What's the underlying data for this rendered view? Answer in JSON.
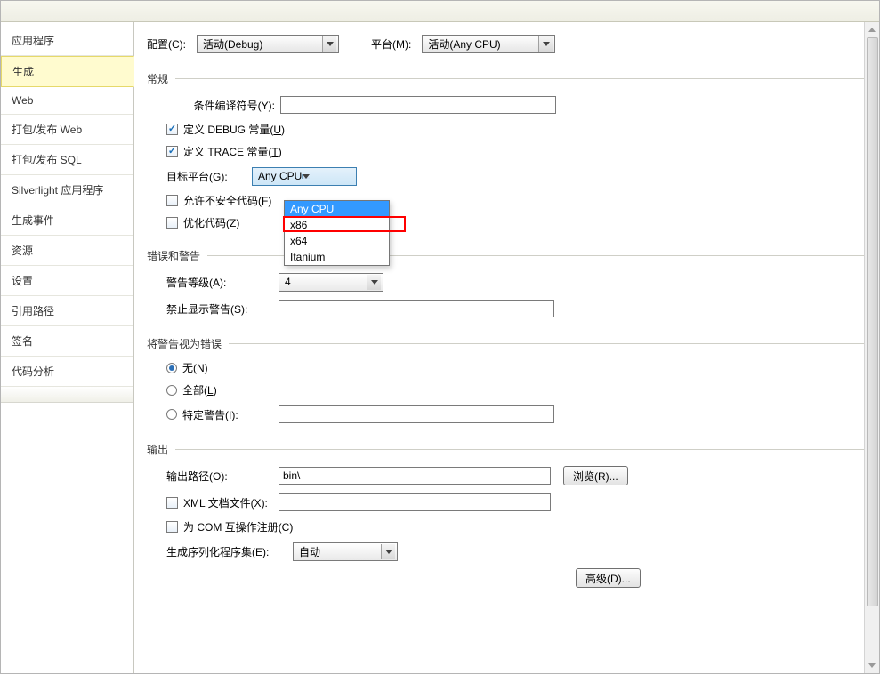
{
  "tabs": {
    "application": "应用程序",
    "build": "生成",
    "web": "Web",
    "pack_web": "打包/发布 Web",
    "pack_sql": "打包/发布 SQL",
    "silverlight": "Silverlight 应用程序",
    "build_events": "生成事件",
    "resources": "资源",
    "settings": "设置",
    "ref_paths": "引用路径",
    "signing": "签名",
    "code_analysis": "代码分析"
  },
  "header": {
    "config_label": "配置(C):",
    "config_value": "活动(Debug)",
    "platform_label": "平台(M):",
    "platform_value": "活动(Any CPU)"
  },
  "sections": {
    "general": "常规",
    "errors": "错误和警告",
    "treat_as_error": "将警告视为错误",
    "output": "输出"
  },
  "general": {
    "cond_compile": "条件编译符号(Y):",
    "debug_const_pre": "定义 DEBUG 常量(",
    "debug_const_u": "U",
    "debug_const_post": ")",
    "trace_const_pre": "定义 TRACE 常量(",
    "trace_const_u": "T",
    "trace_const_post": ")",
    "target_platform": "目标平台(G):",
    "target_value": "Any CPU",
    "target_options": {
      "any": "Any CPU",
      "x86": "x86",
      "x64": "x64",
      "itanium": "Itanium"
    },
    "allow_unsafe": "允许不安全代码(F)",
    "optimize": "优化代码(Z)"
  },
  "errors": {
    "warn_level": "警告等级(A):",
    "warn_level_value": "4",
    "suppress": "禁止显示警告(S):"
  },
  "treat_err": {
    "none_pre": "无(",
    "none_u": "N",
    "none_post": ")",
    "all_pre": "全部(",
    "all_u": "L",
    "all_post": ")",
    "specific": "特定警告(I):"
  },
  "output": {
    "path_label": "输出路径(O):",
    "path_value": "bin\\",
    "browse": "浏览(R)...",
    "xmldoc": "XML 文档文件(X):",
    "com_reg": "为 COM 互操作注册(C)",
    "gen_serial": "生成序列化程序集(E):",
    "gen_serial_value": "自动",
    "advanced": "高级(D)..."
  }
}
